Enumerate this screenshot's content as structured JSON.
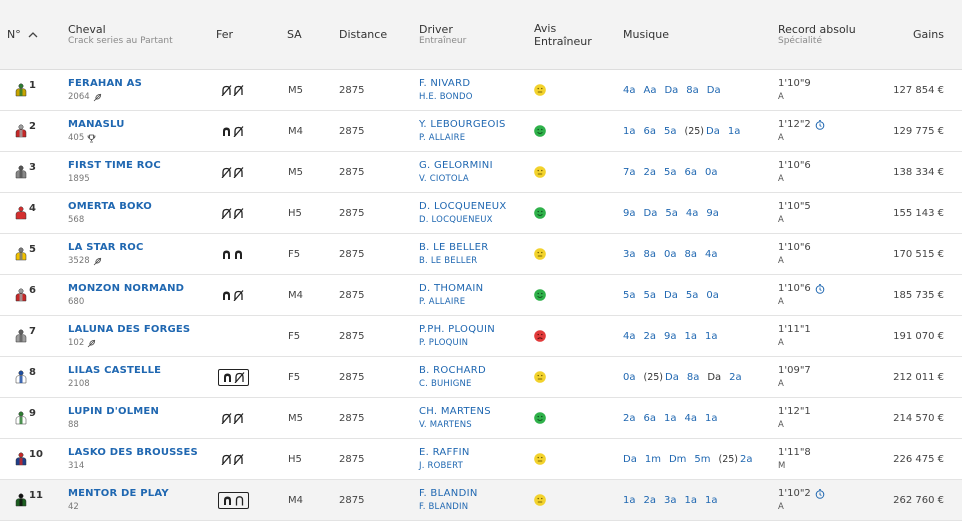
{
  "header": {
    "num": "N°",
    "cheval": "Cheval",
    "cheval_sub": "Crack series au Partant",
    "fer": "Fer",
    "sa": "SA",
    "distance": "Distance",
    "driver": "Driver",
    "driver_sub": "Entraîneur",
    "avis_1": "Avis",
    "avis_2": "Entraîneur",
    "musique": "Musique",
    "record": "Record absolu",
    "record_sub": "Spécialité",
    "gains": "Gains"
  },
  "rows": [
    {
      "num": "1",
      "name": "FERAHAN AS",
      "sub": "2064",
      "sub_icon": "feather-icon",
      "fer": [
        "shoe-off",
        "shoe-off"
      ],
      "fer_boxed": false,
      "sa": "M5",
      "distance": "2875",
      "driver": "F. NIVARD",
      "trainer": "H.E. BONDO",
      "avis": "neutral",
      "musique": [
        {
          "t": "4a"
        },
        {
          "t": "Aa"
        },
        {
          "t": "Da"
        },
        {
          "t": "8a"
        },
        {
          "t": "Da"
        }
      ],
      "record": "1'10\"9",
      "record_clock": false,
      "spec": "A",
      "gains": "127 854 €",
      "jacket": [
        "#c9a400",
        "#2e7d32"
      ]
    },
    {
      "num": "2",
      "name": "MANASLU",
      "sub": "405",
      "sub_icon": "trophy-icon",
      "fer": [
        "shoe-on",
        "shoe-off"
      ],
      "fer_boxed": false,
      "sa": "M4",
      "distance": "2875",
      "driver": "Y. LEBOURGEOIS",
      "trainer": "P. ALLAIRE",
      "avis": "happy",
      "musique": [
        {
          "t": "1a"
        },
        {
          "t": "6a"
        },
        {
          "t": "5a"
        },
        {
          "t": "(25)",
          "year": true
        },
        {
          "t": "Da"
        },
        {
          "t": "1a"
        }
      ],
      "record": "1'12\"2",
      "record_clock": true,
      "spec": "A",
      "gains": "129 775 €",
      "jacket": [
        "#c62828",
        "#9e9e9e"
      ]
    },
    {
      "num": "3",
      "name": "FIRST TIME ROC",
      "sub": "1895",
      "sub_icon": "",
      "fer": [
        "shoe-off",
        "shoe-off"
      ],
      "fer_boxed": false,
      "sa": "M5",
      "distance": "2875",
      "driver": "G. GELORMINI",
      "trainer": "V. CIOTOLA",
      "avis": "neutral",
      "musique": [
        {
          "t": "7a"
        },
        {
          "t": "2a"
        },
        {
          "t": "5a"
        },
        {
          "t": "6a"
        },
        {
          "t": "0a"
        }
      ],
      "record": "1'10\"6",
      "record_clock": false,
      "spec": "A",
      "gains": "138 334 €",
      "jacket": [
        "#888888",
        "#555555"
      ]
    },
    {
      "num": "4",
      "name": "OMERTA BOKO",
      "sub": "568",
      "sub_icon": "",
      "fer": [
        "shoe-off",
        "shoe-off"
      ],
      "fer_boxed": false,
      "sa": "H5",
      "distance": "2875",
      "driver": "D. LOCQUENEUX",
      "trainer": "D. LOCQUENEUX",
      "avis": "happy",
      "musique": [
        {
          "t": "9a"
        },
        {
          "t": "Da"
        },
        {
          "t": "5a"
        },
        {
          "t": "4a"
        },
        {
          "t": "9a"
        }
      ],
      "record": "1'10\"5",
      "record_clock": false,
      "spec": "A",
      "gains": "155 143 €",
      "jacket": [
        "#d32f2f",
        "#d32f2f"
      ]
    },
    {
      "num": "5",
      "name": "LA STAR ROC",
      "sub": "3528",
      "sub_icon": "feather-icon",
      "fer": [
        "shoe-on",
        "shoe-on"
      ],
      "fer_boxed": false,
      "sa": "F5",
      "distance": "2875",
      "driver": "B. LE BELLER",
      "trainer": "B. LE BELLER",
      "avis": "neutral",
      "musique": [
        {
          "t": "3a"
        },
        {
          "t": "8a"
        },
        {
          "t": "0a"
        },
        {
          "t": "8a"
        },
        {
          "t": "4a"
        }
      ],
      "record": "1'10\"6",
      "record_clock": false,
      "spec": "A",
      "gains": "170 515 €",
      "jacket": [
        "#f2c200",
        "#7a7a7a"
      ]
    },
    {
      "num": "6",
      "name": "MONZON NORMAND",
      "sub": "680",
      "sub_icon": "",
      "fer": [
        "shoe-on",
        "shoe-off"
      ],
      "fer_boxed": false,
      "sa": "M4",
      "distance": "2875",
      "driver": "D. THOMAIN",
      "trainer": "P. ALLAIRE",
      "avis": "happy",
      "musique": [
        {
          "t": "5a"
        },
        {
          "t": "5a"
        },
        {
          "t": "Da"
        },
        {
          "t": "5a"
        },
        {
          "t": "0a"
        }
      ],
      "record": "1'10\"6",
      "record_clock": true,
      "spec": "A",
      "gains": "185 735 €",
      "jacket": [
        "#c62828",
        "#9e9e9e"
      ]
    },
    {
      "num": "7",
      "name": "LALUNA DES FORGES",
      "sub": "102",
      "sub_icon": "feather-icon",
      "fer": [],
      "fer_boxed": false,
      "sa": "F5",
      "distance": "2875",
      "driver": "P.PH. PLOQUIN",
      "trainer": "P. PLOQUIN",
      "avis": "sad",
      "musique": [
        {
          "t": "4a"
        },
        {
          "t": "2a"
        },
        {
          "t": "9a"
        },
        {
          "t": "1a"
        },
        {
          "t": "1a"
        }
      ],
      "record": "1'11\"1",
      "record_clock": false,
      "spec": "A",
      "gains": "191 070 €",
      "jacket": [
        "#9e9e9e",
        "#616161"
      ]
    },
    {
      "num": "8",
      "name": "LILAS CASTELLE",
      "sub": "2108",
      "sub_icon": "",
      "fer": [
        "shoe-on",
        "shoe-off"
      ],
      "fer_boxed": true,
      "sa": "F5",
      "distance": "2875",
      "driver": "B. ROCHARD",
      "trainer": "C. BUHIGNE",
      "avis": "neutral",
      "musique": [
        {
          "t": "0a"
        },
        {
          "t": "(25)",
          "year": true
        },
        {
          "t": "Da"
        },
        {
          "t": "8a"
        },
        {
          "t": "Da",
          "dark": true
        },
        {
          "t": "2a"
        }
      ],
      "record": "1'09\"7",
      "record_clock": false,
      "spec": "A",
      "gains": "212 011 €",
      "jacket": [
        "#ffffff",
        "#1e4fa3"
      ]
    },
    {
      "num": "9",
      "name": "LUPIN D'OLMEN",
      "sub": "88",
      "sub_icon": "",
      "fer": [
        "shoe-off",
        "shoe-off"
      ],
      "fer_boxed": false,
      "sa": "M5",
      "distance": "2875",
      "driver": "CH. MARTENS",
      "trainer": "V. MARTENS",
      "avis": "happy",
      "musique": [
        {
          "t": "2a"
        },
        {
          "t": "6a"
        },
        {
          "t": "1a"
        },
        {
          "t": "4a"
        },
        {
          "t": "1a"
        }
      ],
      "record": "1'12\"1",
      "record_clock": false,
      "spec": "A",
      "gains": "214 570 €",
      "jacket": [
        "#ffffff",
        "#2e7d32"
      ]
    },
    {
      "num": "10",
      "name": "LASKO DES BROUSSES",
      "sub": "314",
      "sub_icon": "",
      "fer": [
        "shoe-off",
        "shoe-off"
      ],
      "fer_boxed": false,
      "sa": "H5",
      "distance": "2875",
      "driver": "E. RAFFIN",
      "trainer": "J. ROBERT",
      "avis": "neutral",
      "musique": [
        {
          "t": "Da"
        },
        {
          "t": "1m"
        },
        {
          "t": "Dm"
        },
        {
          "t": "5m"
        },
        {
          "t": "(25)",
          "year": true
        },
        {
          "t": "2a"
        }
      ],
      "record": "1'11\"8",
      "record_clock": false,
      "spec": "M",
      "gains": "226 475 €",
      "jacket": [
        "#1e3f8a",
        "#c62828"
      ]
    },
    {
      "num": "11",
      "name": "MENTOR DE PLAY",
      "sub": "42",
      "sub_icon": "",
      "fer": [
        "shoe-on",
        "shoe-arch"
      ],
      "fer_boxed": true,
      "sa": "M4",
      "distance": "2875",
      "driver": "F. BLANDIN",
      "trainer": "F. BLANDIN",
      "avis": "neutral",
      "musique": [
        {
          "t": "1a"
        },
        {
          "t": "2a"
        },
        {
          "t": "3a"
        },
        {
          "t": "1a"
        },
        {
          "t": "1a"
        }
      ],
      "record": "1'10\"2",
      "record_clock": true,
      "spec": "A",
      "gains": "262 760 €",
      "jacket": [
        "#1b5e20",
        "#111111"
      ]
    }
  ]
}
